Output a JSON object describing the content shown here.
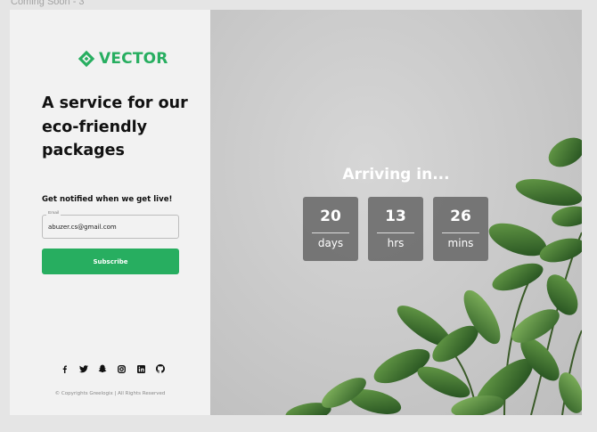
{
  "frame_label": "Coming Soon - 3",
  "brand": {
    "name": "VECTOR",
    "color": "#27ae60",
    "icon": "diamond-logo-icon"
  },
  "headline": "A service for our eco-friendly packages",
  "notify_heading": "Get notified when we get live!",
  "email_field": {
    "legend": "Email",
    "value": "abuzer.cs@gmail.com"
  },
  "subscribe_label": "Subscribe",
  "socials": [
    {
      "name": "facebook-icon"
    },
    {
      "name": "twitter-icon"
    },
    {
      "name": "snapchat-icon"
    },
    {
      "name": "instagram-icon"
    },
    {
      "name": "linkedin-icon"
    },
    {
      "name": "github-icon"
    }
  ],
  "copyright": "© Copyrights Greelogix | All Rights Reserved",
  "hero": {
    "heading": "Arriving in...",
    "countdown": [
      {
        "value": "20",
        "unit": "days"
      },
      {
        "value": "13",
        "unit": "hrs"
      },
      {
        "value": "26",
        "unit": "mins"
      }
    ]
  },
  "colors": {
    "accent": "#27ae60",
    "panel": "#f2f2f2",
    "countdown_box": "#696969"
  }
}
